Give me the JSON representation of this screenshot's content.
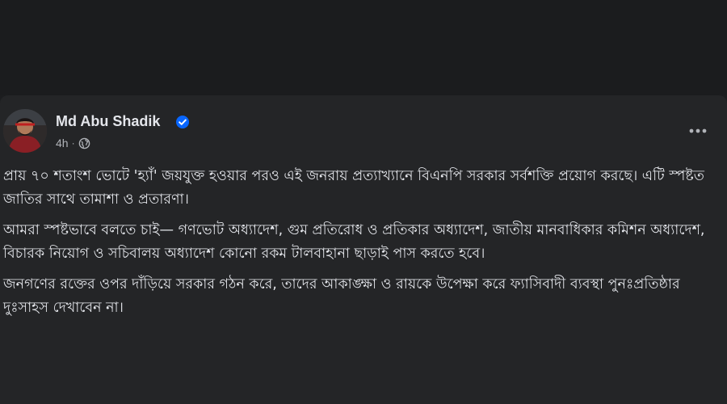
{
  "post": {
    "author": {
      "name": "Md Abu Shadik",
      "verified": true,
      "avatar": "avatar-photo"
    },
    "time": "4h",
    "separator": "·",
    "audience_icon": "globe-icon",
    "more_icon": "more-horizontal-icon",
    "paragraphs": [
      "প্রায় ৭০ শতাংশ ভোটে 'হ্যাঁ' জয়যুক্ত হওয়ার পরও এই জনরায় প্রত্যাখ্যানে বিএনপি সরকার সর্বশক্তি প্রয়োগ করছে। এটি স্পষ্টত জাতির সাথে তামাশা ও প্রতারণা।",
      "আমরা স্পষ্টভাবে বলতে চাই— গণভোট অধ্যাদেশ, গুম প্রতিরোধ ও প্রতিকার অধ্যাদেশ, জাতীয় মানবাধিকার কমিশন অধ্যাদেশ, বিচারক নিয়োগ ও সচিবালয় অধ্যাদেশ কোনো রকম টালবাহানা ছাড়াই পাস করতে হবে।",
      "জনগণের রক্তের ওপর দাঁড়িয়ে সরকার গঠন করে, তাদের আকাঙ্ক্ষা ও রায়কে উপেক্ষা করে ফ্যাসিবাদী ব্যবস্থা পুনঃপ্রতিষ্ঠার দুঃসাহস দেখাবেন না।"
    ]
  },
  "colors": {
    "background": "#1c1d1f",
    "card": "#242527",
    "primary_text": "#e4e6eb",
    "secondary_text": "#b0b3b8",
    "verified_blue": "#0866ff"
  }
}
